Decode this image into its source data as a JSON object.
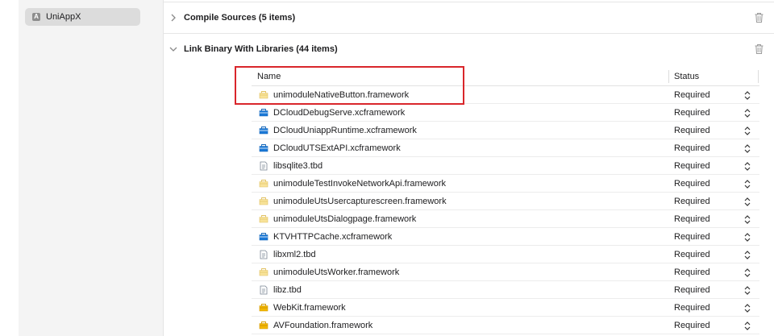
{
  "sidebar": {
    "target": {
      "label": "UniAppX",
      "icon": "app-target-icon"
    }
  },
  "sections": {
    "compile_sources": {
      "title": "Compile Sources (5 items)",
      "expanded": false
    },
    "link_binary": {
      "title": "Link Binary With Libraries (44 items)",
      "expanded": true
    }
  },
  "table": {
    "headers": {
      "name": "Name",
      "status": "Status"
    },
    "rows": [
      {
        "name": "unimoduleNativeButton.framework",
        "status": "Required",
        "icon": "framework-yellow-icon"
      },
      {
        "name": "DCloudDebugServe.xcframework",
        "status": "Required",
        "icon": "xcframework-blue-icon"
      },
      {
        "name": "DCloudUniappRuntime.xcframework",
        "status": "Required",
        "icon": "xcframework-blue-icon"
      },
      {
        "name": "DCloudUTSExtAPI.xcframework",
        "status": "Required",
        "icon": "xcframework-blue-icon"
      },
      {
        "name": "libsqlite3.tbd",
        "status": "Required",
        "icon": "tbd-file-icon"
      },
      {
        "name": "unimoduleTestInvokeNetworkApi.framework",
        "status": "Required",
        "icon": "framework-yellow-icon"
      },
      {
        "name": "unimoduleUtsUsercapturescreen.framework",
        "status": "Required",
        "icon": "framework-yellow-icon"
      },
      {
        "name": "unimoduleUtsDialogpage.framework",
        "status": "Required",
        "icon": "framework-yellow-icon"
      },
      {
        "name": "KTVHTTPCache.xcframework",
        "status": "Required",
        "icon": "xcframework-blue-icon"
      },
      {
        "name": "libxml2.tbd",
        "status": "Required",
        "icon": "tbd-file-icon"
      },
      {
        "name": "unimoduleUtsWorker.framework",
        "status": "Required",
        "icon": "framework-yellow-icon"
      },
      {
        "name": "libz.tbd",
        "status": "Required",
        "icon": "tbd-file-icon"
      },
      {
        "name": "WebKit.framework",
        "status": "Required",
        "icon": "system-framework-icon"
      },
      {
        "name": "AVFoundation.framework",
        "status": "Required",
        "icon": "system-framework-icon"
      }
    ]
  },
  "colors": {
    "highlight": "#d9262b",
    "xcframework": "#1a78d6",
    "framework_light": "#f5d76e",
    "framework_system": "#f0b400"
  }
}
